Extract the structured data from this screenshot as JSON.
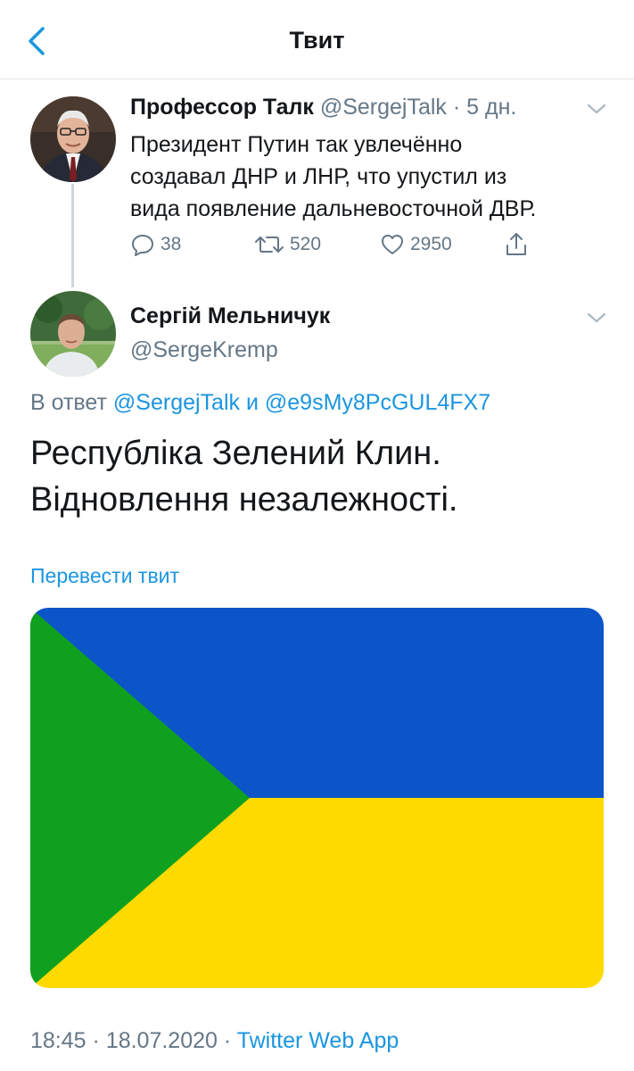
{
  "header": {
    "title": "Твит",
    "back_icon": "chevron-left-icon"
  },
  "tweet1": {
    "name": "Профессор Талк",
    "handle": "@SergejTalk",
    "separator": "·",
    "age": "5 дн.",
    "text_lines": [
      "Президент Путин так увлечённо",
      "создавал ДНР и ЛНР, что  упустил из",
      "вида появление дальневосточной ДВР."
    ],
    "actions": {
      "replies": "38",
      "retweets": "520",
      "likes": "2950"
    }
  },
  "tweet2": {
    "name": "Сергій Мельничук",
    "handle": "@SergeKremp",
    "reply_prefix": "В ответ",
    "reply_user1": "@SergejTalk",
    "reply_and": "и",
    "reply_user2": "@e9sMy8PcGUL4FX7",
    "text_lines": [
      "Республіка Зелений Клин.",
      "Відновлення незалежності."
    ],
    "translate": "Перевести твит",
    "time": "18:45",
    "date": "18.07.2020",
    "separator": "·",
    "source": "Twitter Web App"
  },
  "colors": {
    "link": "#1b95e0",
    "muted": "#657786",
    "flag_blue": "#0c55c8",
    "flag_yellow": "#ffda00",
    "flag_green": "#10a020"
  }
}
